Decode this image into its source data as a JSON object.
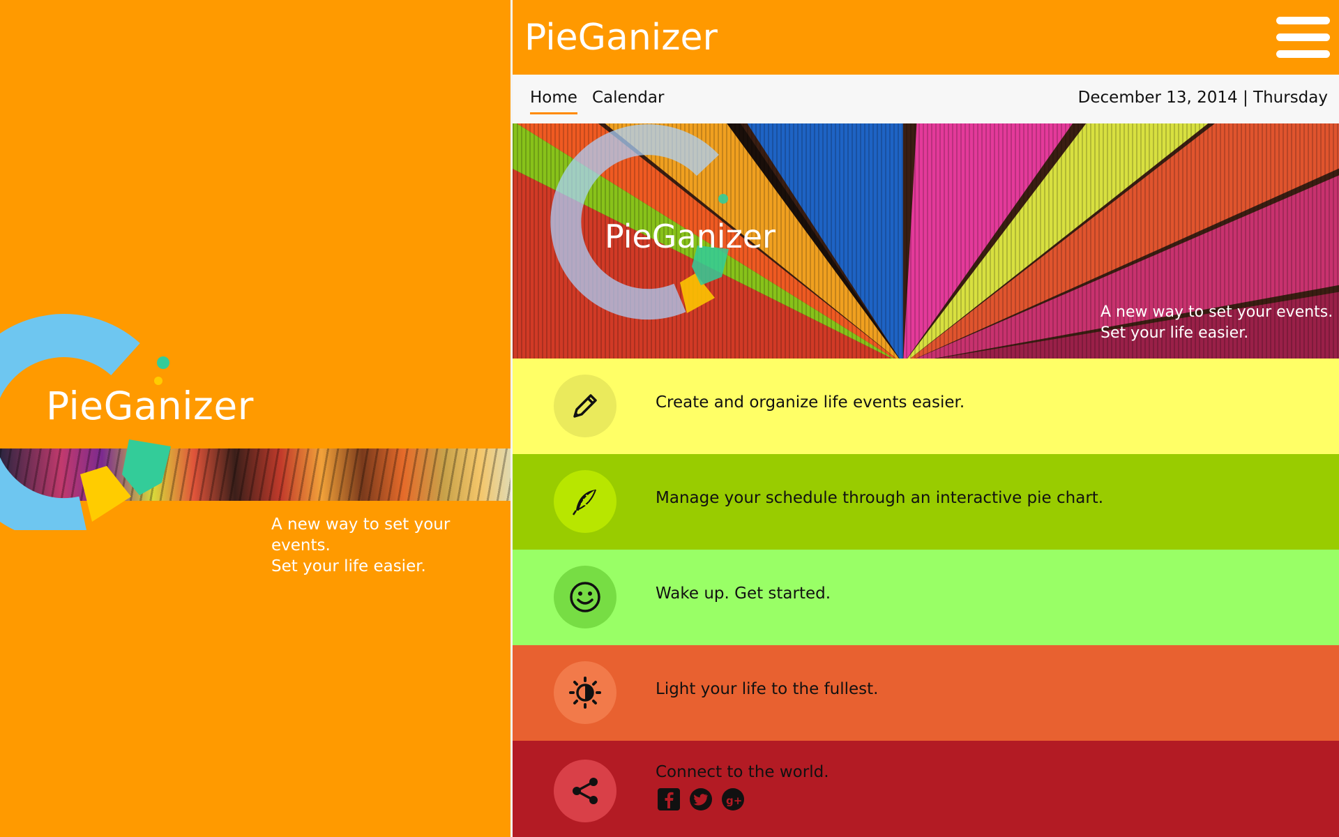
{
  "splash": {
    "title": "PieGanizer",
    "tagline_line1": "A new way to set your events.",
    "tagline_line2": "Set your life easier."
  },
  "app": {
    "title": "PieGanizer",
    "menu_icon": "hamburger-menu-icon",
    "nav": {
      "tabs": [
        {
          "label": "Home",
          "active": true
        },
        {
          "label": "Calendar",
          "active": false
        }
      ],
      "date": "December 13, 2014 | Thursday"
    },
    "hero": {
      "title": "PieGanizer",
      "tagline_line1": "A new way to set your events.",
      "tagline_line2": "Set your life easier."
    },
    "features": [
      {
        "icon": "pencil-icon",
        "text": "Create and organize life events easier.",
        "color": "#ffff66"
      },
      {
        "icon": "feather-icon",
        "text": "Manage your schedule through an interactive pie chart.",
        "color": "#99cc00"
      },
      {
        "icon": "smiley-icon",
        "text": "Wake up. Get started.",
        "color": "#99ff66"
      },
      {
        "icon": "brightness-icon",
        "text": "Light your life to the fullest.",
        "color": "#e86130"
      },
      {
        "icon": "share-icon",
        "text": "Connect to the world.",
        "color": "#b31b24"
      }
    ],
    "social": [
      "facebook-icon",
      "twitter-icon",
      "google-plus-icon"
    ]
  },
  "colors": {
    "brand_orange": "#ff9900",
    "logo_blue": "#6ec6f0",
    "logo_yellow": "#ffcc00",
    "logo_teal": "#33cc99"
  }
}
